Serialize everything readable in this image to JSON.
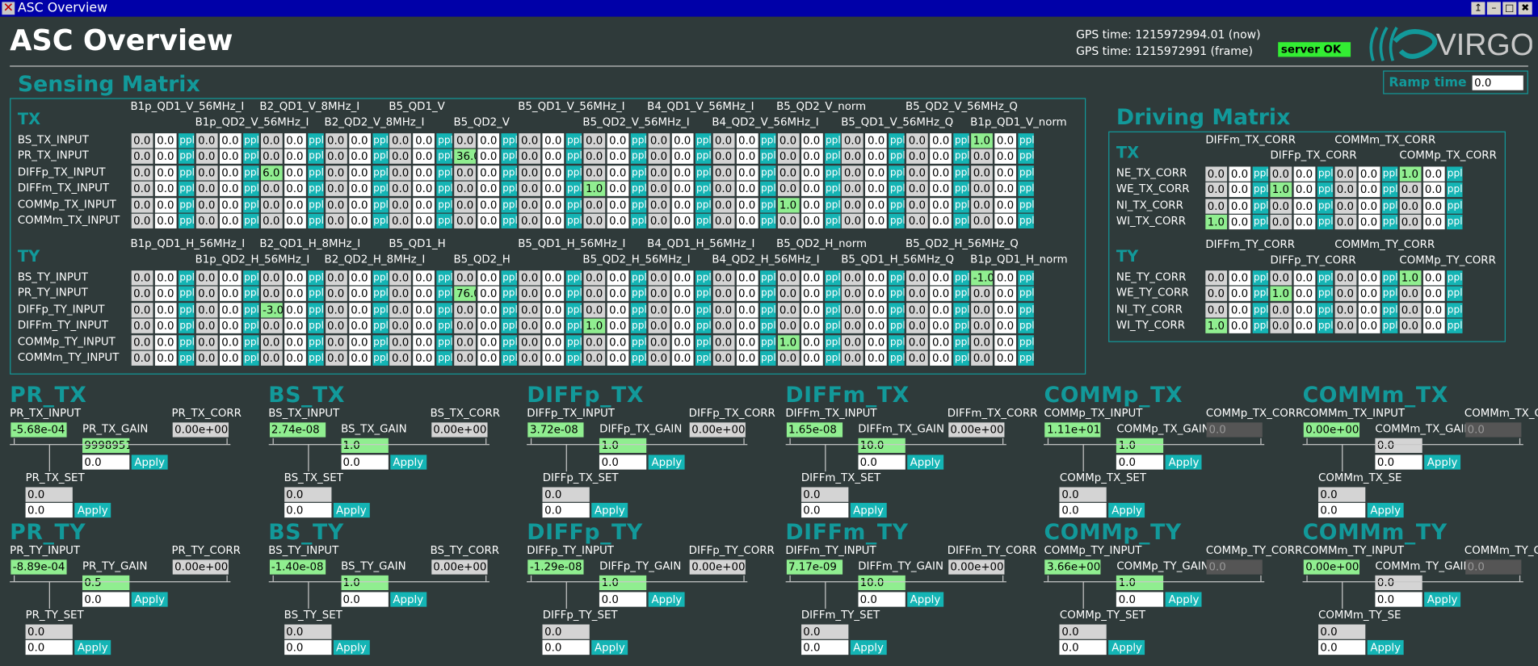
{
  "window": {
    "title": "ASC Overview",
    "buttons": [
      "↥",
      "–",
      "□",
      "✖"
    ]
  },
  "header": {
    "title": "ASC Overview",
    "gps_now": "GPS time: 1215972994.01 (now)",
    "gps_frame": "GPS time: 1215972991 (frame)",
    "server_status": "server OK",
    "logo_text": "VIRGO"
  },
  "sensing": {
    "title": "Sensing Matrix",
    "tx": {
      "heading": "TX",
      "cols_top": [
        "B1p_QD1_V_56MHz_I",
        "B2_QD1_V_8MHz_I",
        "B5_QD1_V",
        "B5_QD1_V_56MHz_I",
        "B4_QD1_V_56MHz_I",
        "B5_QD2_V_norm",
        "B5_QD2_V_56MHz_Q"
      ],
      "cols_bottom": [
        "B1p_QD2_V_56MHz_I",
        "B2_QD2_V_8MHz_I",
        "B5_QD2_V",
        "B5_QD2_V_56MHz_I",
        "B4_QD2_V_56MHz_I",
        "B5_QD1_V_56MHz_Q",
        "B1p_QD1_V_norm"
      ],
      "rows": [
        {
          "label": "BS_TX_INPUT",
          "hl": [
            [
              13,
              "1.0"
            ]
          ]
        },
        {
          "label": "PR_TX_INPUT",
          "hl": [
            [
              5,
              "36.0"
            ]
          ]
        },
        {
          "label": "DIFFp_TX_INPUT",
          "hl": [
            [
              2,
              "6.0"
            ]
          ]
        },
        {
          "label": "DIFFm_TX_INPUT",
          "hl": [
            [
              7,
              "1.0"
            ]
          ]
        },
        {
          "label": "COMMp_TX_INPUT",
          "hl": [
            [
              10,
              "1.0"
            ]
          ]
        },
        {
          "label": "COMMm_TX_INPUT",
          "hl": []
        }
      ]
    },
    "ty": {
      "heading": "TY",
      "cols_top": [
        "B1p_QD1_H_56MHz_I",
        "B2_QD1_H_8MHz_I",
        "B5_QD1_H",
        "B5_QD1_H_56MHz_I",
        "B4_QD1_H_56MHz_I",
        "B5_QD2_H_norm",
        "B5_QD2_H_56MHz_Q"
      ],
      "cols_bottom": [
        "B1p_QD2_H_56MHz_I",
        "B2_QD2_H_8MHz_I",
        "B5_QD2_H",
        "B5_QD2_H_56MHz_I",
        "B4_QD2_H_56MHz_I",
        "B5_QD1_H_56MHz_Q",
        "B1p_QD1_H_norm"
      ],
      "rows": [
        {
          "label": "BS_TY_INPUT",
          "hl": [
            [
              13,
              "-1.0"
            ]
          ]
        },
        {
          "label": "PR_TY_INPUT",
          "hl": [
            [
              5,
              "76.0"
            ]
          ]
        },
        {
          "label": "DIFFp_TY_INPUT",
          "hl": [
            [
              2,
              "-3.0"
            ]
          ]
        },
        {
          "label": "DIFFm_TY_INPUT",
          "hl": [
            [
              7,
              "1.0"
            ]
          ]
        },
        {
          "label": "COMMp_TY_INPUT",
          "hl": [
            [
              10,
              "1.0"
            ]
          ]
        },
        {
          "label": "COMMm_TY_INPUT",
          "hl": []
        }
      ]
    },
    "cell_default": "0.0",
    "pp_label": "ppl"
  },
  "ramp": {
    "label": "Ramp time",
    "value": "0.0"
  },
  "driving": {
    "title": "Driving Matrix",
    "tx": {
      "heading": "TX",
      "cols_top": [
        "DIFFm_TX_CORR",
        "COMMm_TX_CORR"
      ],
      "cols_bottom": [
        "DIFFp_TX_CORR",
        "COMMp_TX_CORR"
      ],
      "rows": [
        {
          "label": "NE_TX_CORR",
          "hl": [
            [
              3,
              "1.0"
            ]
          ]
        },
        {
          "label": "WE_TX_CORR",
          "hl": [
            [
              1,
              "1.0"
            ]
          ]
        },
        {
          "label": "NI_TX_CORR",
          "hl": []
        },
        {
          "label": "WI_TX_CORR",
          "hl": [
            [
              0,
              "1.0"
            ]
          ]
        }
      ]
    },
    "ty": {
      "heading": "TY",
      "cols_top": [
        "DIFFm_TY_CORR",
        "COMMm_TY_CORR"
      ],
      "cols_bottom": [
        "DIFFp_TY_CORR",
        "COMMp_TY_CORR"
      ],
      "rows": [
        {
          "label": "NE_TY_CORR",
          "hl": [
            [
              3,
              "1.0"
            ]
          ]
        },
        {
          "label": "WE_TY_CORR",
          "hl": [
            [
              1,
              "1.0"
            ]
          ]
        },
        {
          "label": "NI_TY_CORR",
          "hl": []
        },
        {
          "label": "WI_TY_CORR",
          "hl": [
            [
              0,
              "1.0"
            ]
          ]
        }
      ]
    }
  },
  "dofs": [
    {
      "title": "PR_TX",
      "input_label": "PR_TX_INPUT",
      "input_value": "-5.68e-04",
      "gain_label": "PR_TX_GAIN",
      "gain_value": "9998951",
      "gain_set": "0.0",
      "corr_label": "PR_TX_CORR",
      "corr_value": "0.00e+00",
      "set_label": "PR_TX_SET",
      "set_value": "0.0",
      "set_input": "0.0",
      "apply": "Apply",
      "gain_style": "lg",
      "corr_style": "g"
    },
    {
      "title": "BS_TX",
      "input_label": "BS_TX_INPUT",
      "input_value": "2.74e-08",
      "gain_label": "BS_TX_GAIN",
      "gain_value": "1.0",
      "gain_set": "0.0",
      "corr_label": "BS_TX_CORR",
      "corr_value": "0.00e+00",
      "set_label": "BS_TX_SET",
      "set_value": "0.0",
      "set_input": "0.0",
      "apply": "Apply",
      "gain_style": "lg",
      "corr_style": "g"
    },
    {
      "title": "DIFFp_TX",
      "input_label": "DIFFp_TX_INPUT",
      "input_value": "3.72e-08",
      "gain_label": "DIFFp_TX_GAIN",
      "gain_value": "1.0",
      "gain_set": "0.0",
      "corr_label": "DIFFp_TX_CORR",
      "corr_value": "0.00e+00",
      "set_label": "DIFFp_TX_SET",
      "set_value": "0.0",
      "set_input": "0.0",
      "apply": "Apply",
      "gain_style": "lg",
      "corr_style": "g"
    },
    {
      "title": "DIFFm_TX",
      "input_label": "DIFFm_TX_INPUT",
      "input_value": "1.65e-08",
      "gain_label": "DIFFm_TX_GAIN",
      "gain_value": "10.0",
      "gain_set": "0.0",
      "corr_label": "DIFFm_TX_CORR",
      "corr_value": "0.00e+00",
      "set_label": "DIFFm_TX_SET",
      "set_value": "0.0",
      "set_input": "0.0",
      "apply": "Apply",
      "gain_style": "lg",
      "corr_style": "g"
    },
    {
      "title": "COMMp_TX",
      "input_label": "COMMp_TX_INPUT",
      "input_value": "1.11e+01",
      "gain_label": "COMMp_TX_GAIN",
      "gain_value": "1.0",
      "gain_set": "0.0",
      "corr_label": "COMMp_TX_CORR",
      "corr_value": "0.0",
      "set_label": "COMMp_TX_SET",
      "set_value": "0.0",
      "set_input": "0.0",
      "apply": "Apply",
      "gain_style": "lg",
      "corr_style": "dk"
    },
    {
      "title": "COMMm_TX",
      "input_label": "COMMm_TX_INPUT",
      "input_value": "0.00e+00",
      "gain_label": "COMMm_TX_GAIN",
      "gain_value": "0.0",
      "gain_set": "0.0",
      "corr_label": "COMMm_TX_CORR",
      "corr_value": "0.0",
      "set_label": "COMMm_TX_SE",
      "set_value": "0.0",
      "set_input": "0.0",
      "apply": "Apply",
      "gain_style": "g",
      "corr_style": "dk"
    },
    {
      "title": "PR_TY",
      "input_label": "PR_TY_INPUT",
      "input_value": "-8.89e-04",
      "gain_label": "PR_TY_GAIN",
      "gain_value": "0.5",
      "gain_set": "0.0",
      "corr_label": "PR_TY_CORR",
      "corr_value": "0.00e+00",
      "set_label": "PR_TY_SET",
      "set_value": "0.0",
      "set_input": "0.0",
      "apply": "Apply",
      "gain_style": "lg",
      "corr_style": "g"
    },
    {
      "title": "BS_TY",
      "input_label": "BS_TY_INPUT",
      "input_value": "-1.40e-08",
      "gain_label": "BS_TY_GAIN",
      "gain_value": "1.0",
      "gain_set": "0.0",
      "corr_label": "BS_TY_CORR",
      "corr_value": "0.00e+00",
      "set_label": "BS_TY_SET",
      "set_value": "0.0",
      "set_input": "0.0",
      "apply": "Apply",
      "gain_style": "lg",
      "corr_style": "g"
    },
    {
      "title": "DIFFp_TY",
      "input_label": "DIFFp_TY_INPUT",
      "input_value": "-1.29e-08",
      "gain_label": "DIFFp_TY_GAIN",
      "gain_value": "1.0",
      "gain_set": "0.0",
      "corr_label": "DIFFp_TY_CORR",
      "corr_value": "0.00e+00",
      "set_label": "DIFFp_TY_SET",
      "set_value": "0.0",
      "set_input": "0.0",
      "apply": "Apply",
      "gain_style": "lg",
      "corr_style": "g"
    },
    {
      "title": "DIFFm_TY",
      "input_label": "DIFFm_TY_INPUT",
      "input_value": "7.17e-09",
      "gain_label": "DIFFm_TY_GAIN",
      "gain_value": "10.0",
      "gain_set": "0.0",
      "corr_label": "DIFFm_TY_CORR",
      "corr_value": "0.00e+00",
      "set_label": "DIFFm_TY_SET",
      "set_value": "0.0",
      "set_input": "0.0",
      "apply": "Apply",
      "gain_style": "lg",
      "corr_style": "g"
    },
    {
      "title": "COMMp_TY",
      "input_label": "COMMp_TY_INPUT",
      "input_value": "3.66e+00",
      "gain_label": "COMMp_TY_GAIN",
      "gain_value": "1.0",
      "gain_set": "0.0",
      "corr_label": "COMMp_TY_CORR",
      "corr_value": "0.0",
      "set_label": "COMMp_TY_SET",
      "set_value": "0.0",
      "set_input": "0.0",
      "apply": "Apply",
      "gain_style": "lg",
      "corr_style": "dk"
    },
    {
      "title": "COMMm_TY",
      "input_label": "COMMm_TY_INPUT",
      "input_value": "0.00e+00",
      "gain_label": "COMMm_TY_GAIN",
      "gain_value": "0.0",
      "gain_set": "0.0",
      "corr_label": "COMMm_TY_CORR",
      "corr_value": "0.0",
      "set_label": "COMMm_TY_SE",
      "set_value": "0.0",
      "set_input": "0.0",
      "apply": "Apply",
      "gain_style": "g",
      "corr_style": "dk"
    }
  ],
  "colors": {
    "teal": "#12999a",
    "cyan": "#14b4b4",
    "highlight": "#90ee90",
    "titlebar": "#0000a8",
    "background": "#2f3a3a"
  }
}
